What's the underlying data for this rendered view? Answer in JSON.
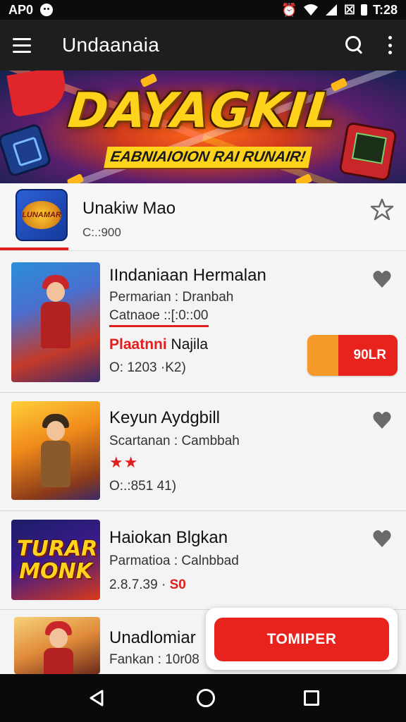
{
  "status_bar": {
    "left_text": "AP0",
    "time": "T:28"
  },
  "app_bar": {
    "title": "Undaanaia"
  },
  "banner": {
    "title": "DAYAGKIL",
    "subtitle": "EABNIAIOION RAI RUNAIR!"
  },
  "featured": {
    "icon_text": "LUNAMAR",
    "title": "Unakiw Mao",
    "meta": "C:.:900"
  },
  "games": [
    {
      "title": "IIndaniaan Hermalan",
      "line1": "Permarian : Dranbah",
      "line2": "Catnaoe ::[:0::00",
      "tag_red": "Plaatnni",
      "tag_dark": "Najila",
      "meta": "O: 1203 ·K2)",
      "button": "90LR"
    },
    {
      "title": "Keyun Aydgbill",
      "line1": "Scartanan : Cambbah",
      "stars": "★★",
      "meta": "O:.:851 41)"
    },
    {
      "title": "Haiokan Blgkan",
      "line1": "Parmatioa : Calnbbad",
      "meta_prefix": "2.8.7.39 ·",
      "meta_price": "S0",
      "thumb_text": "TURAR MONK"
    },
    {
      "title": "Unadlomiar",
      "line1": "Fankan : 10r08"
    }
  ],
  "cta": {
    "label": "TOMIPER"
  },
  "colors": {
    "accent": "#e8221c",
    "app_bar": "#1e1e1e",
    "heart": "#6a6a6a"
  }
}
